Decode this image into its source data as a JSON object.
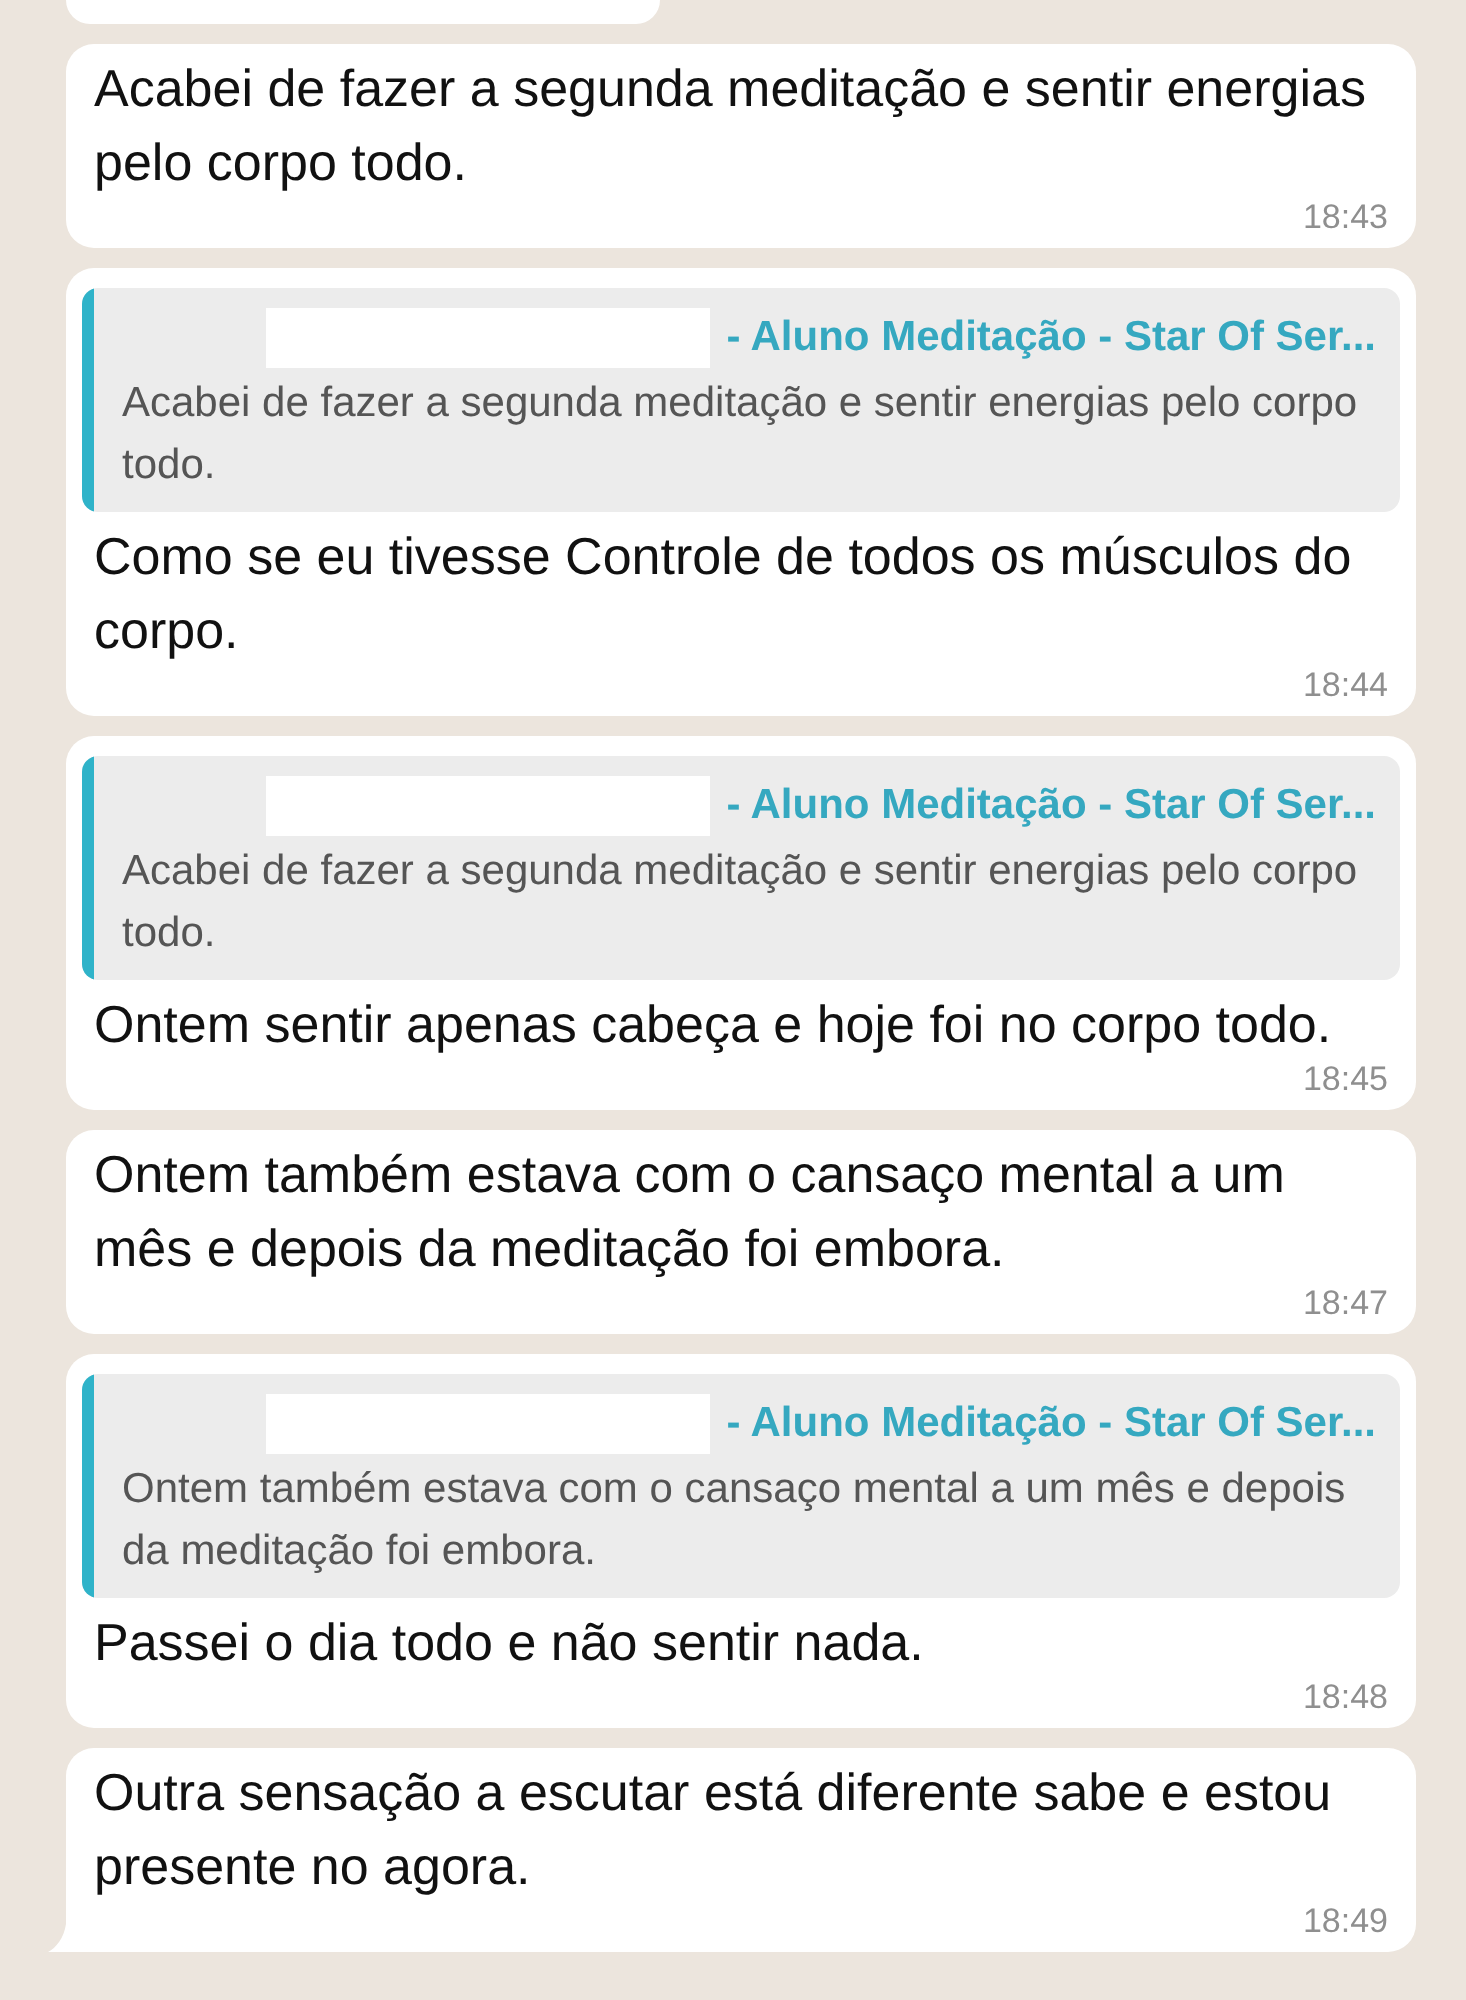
{
  "messages": [
    {
      "kind": "partial"
    },
    {
      "kind": "text",
      "text": "Acabei de fazer a segunda meditação e sentir energias pelo corpo todo.",
      "time": "18:43",
      "tail": false
    },
    {
      "kind": "reply",
      "quote": {
        "author_redacted": true,
        "author": "- Aluno Meditação - Star Of Ser...",
        "text": "Acabei de fazer a segunda meditação e sentir energias pelo corpo todo."
      },
      "text": "Como se eu tivesse Controle de  todos os músculos do corpo.",
      "time": "18:44",
      "tail": false
    },
    {
      "kind": "reply",
      "quote": {
        "author_redacted": true,
        "author": "- Aluno Meditação - Star Of Ser...",
        "text": "Acabei de fazer a segunda meditação e sentir energias pelo corpo todo."
      },
      "text": "Ontem sentir apenas cabeça e hoje foi no corpo todo.",
      "time": "18:45",
      "tail": false
    },
    {
      "kind": "text",
      "text": "Ontem também estava com o cansaço mental a um mês e depois da meditação foi embora.",
      "time": "18:47",
      "tail": false
    },
    {
      "kind": "reply",
      "quote": {
        "author_redacted": true,
        "author": "- Aluno Meditação - Star Of Ser...",
        "text": "Ontem também estava com o cansaço mental a um mês e depois da meditação foi embora."
      },
      "text": "Passei o dia todo e não sentir nada.",
      "time": "18:48",
      "tail": false
    },
    {
      "kind": "text",
      "text": "Outra sensação a escutar está diferente sabe e estou presente no agora.",
      "time": "18:49",
      "tail": true
    }
  ]
}
